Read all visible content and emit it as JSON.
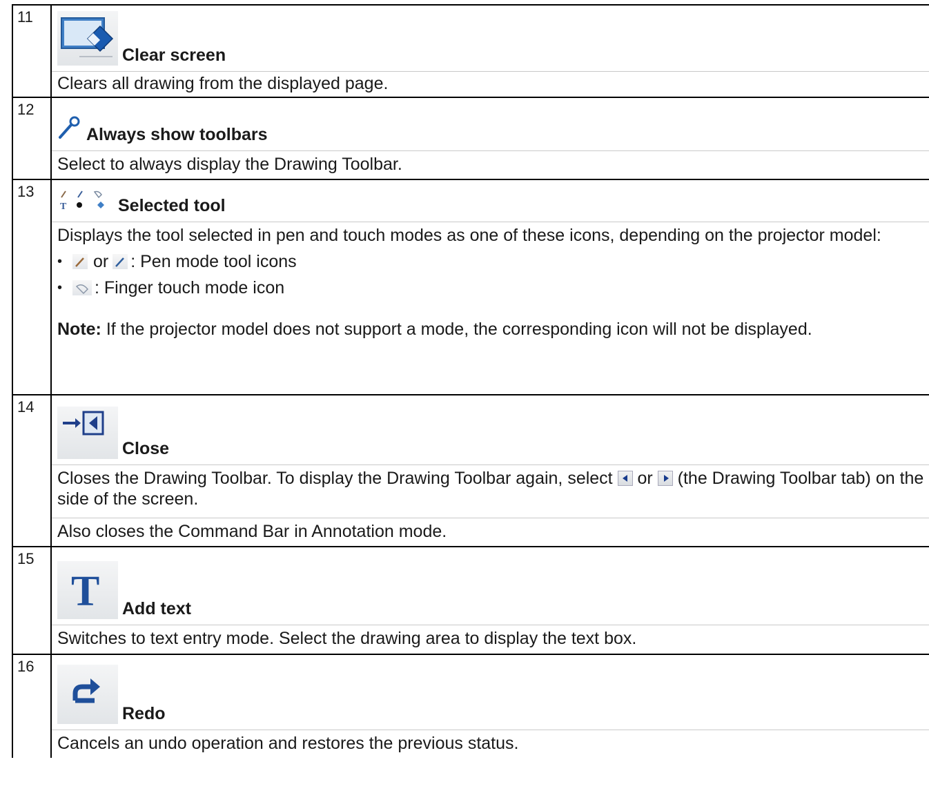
{
  "rows": [
    {
      "num": "11",
      "icon": "clear-screen-icon",
      "title": "Clear screen",
      "lines": [
        "Clears all drawing from the displayed page."
      ]
    },
    {
      "num": "12",
      "icon": "pin-icon",
      "title": "Always show toolbars",
      "lines": [
        "Select to always display the Drawing Toolbar."
      ]
    },
    {
      "num": "13",
      "icon": "selected-tool-icons",
      "title": "Selected tool",
      "lines": [
        "Displays the tool selected in pen and touch modes as one of these icons, depending on the projector model:"
      ],
      "bullets": [
        {
          "sep": "or",
          "text": ": Pen mode tool icons"
        },
        {
          "text": ": Finger touch mode icon"
        }
      ],
      "note_label": "Note:",
      "note_text": " If the projector model does not support a mode, the corresponding icon will not be displayed."
    },
    {
      "num": "14",
      "icon": "close-toolbar-icon",
      "title": "Close",
      "line1_a": "Closes the Drawing Toolbar. To display the Drawing Toolbar again, select ",
      "line1_or": " or ",
      "line1_b": " (the Drawing Toolbar tab) on the side of the screen.",
      "line2": "Also closes the Command Bar in Annotation mode."
    },
    {
      "num": "15",
      "icon": "text-icon",
      "title": "Add text",
      "lines": [
        "Switches to text entry mode. Select the drawing area to display the text box."
      ]
    },
    {
      "num": "16",
      "icon": "redo-icon",
      "title": "Redo",
      "lines": [
        "Cancels an undo operation and restores the previous status."
      ]
    }
  ]
}
